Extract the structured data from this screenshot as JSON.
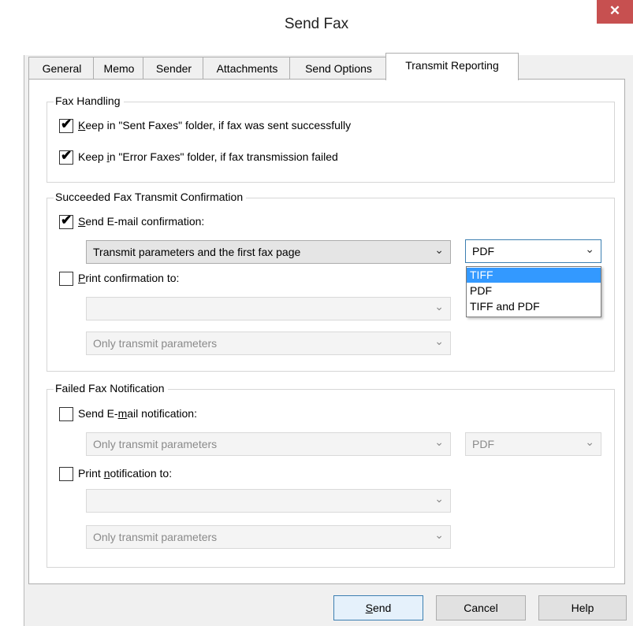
{
  "window": {
    "title": "Send Fax",
    "close_glyph": "✕"
  },
  "tabs": [
    {
      "label": "General"
    },
    {
      "label": "Memo"
    },
    {
      "label": "Sender"
    },
    {
      "label": "Attachments"
    },
    {
      "label": "Send Options"
    },
    {
      "label": "Transmit Reporting",
      "active": true
    }
  ],
  "fax_handling": {
    "title": "Fax Handling",
    "keep_sent": {
      "before": "",
      "mnemonic": "K",
      "after": "eep in \"Sent Faxes\" folder, if fax was sent successfully",
      "checked": true
    },
    "keep_error": {
      "before": "Keep ",
      "mnemonic": "i",
      "after": "n \"Error Faxes\" folder, if fax transmission failed",
      "checked": true
    }
  },
  "succeeded": {
    "title": "Succeeded Fax Transmit Confirmation",
    "email": {
      "before": "",
      "mnemonic": "S",
      "after": "end E-mail confirmation:",
      "checked": true
    },
    "email_content": "Transmit parameters and the first fax page",
    "email_format": "PDF",
    "format_options": [
      "TIFF",
      "PDF",
      "TIFF and PDF"
    ],
    "format_highlighted": "TIFF",
    "print": {
      "before": "",
      "mnemonic": "P",
      "after": "rint confirmation to:",
      "checked": false
    },
    "printer": "",
    "print_content": "Only transmit parameters"
  },
  "failed": {
    "title": "Failed Fax Notification",
    "email": {
      "before": "Send E-",
      "mnemonic": "m",
      "after": "ail notification:",
      "checked": false
    },
    "email_content": "Only transmit parameters",
    "email_format": "PDF",
    "print": {
      "before": "Print ",
      "mnemonic": "n",
      "after": "otification to:",
      "checked": false
    },
    "printer": "",
    "print_content": "Only transmit parameters"
  },
  "buttons": {
    "send": {
      "before": "",
      "mnemonic": "S",
      "after": "end"
    },
    "cancel": "Cancel",
    "help": "Help"
  },
  "icons": {
    "checkmark": "✔",
    "dropdown_arrow": "⌄"
  }
}
